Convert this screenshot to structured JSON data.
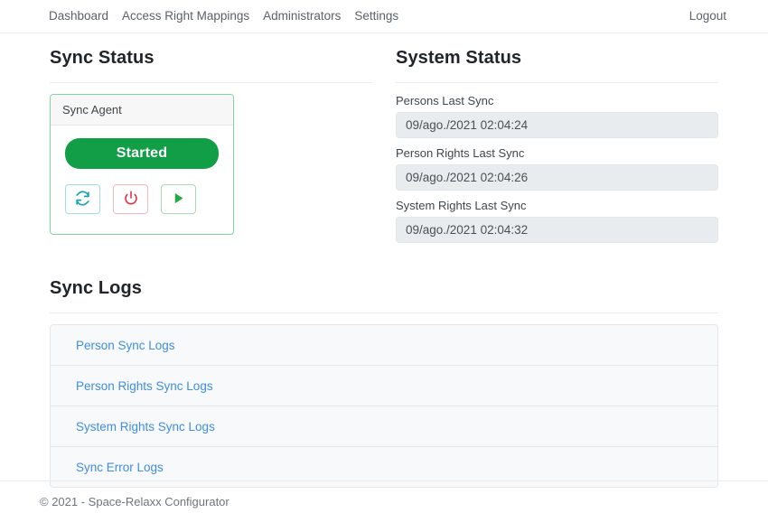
{
  "navbar": {
    "links": [
      {
        "label": "Dashboard"
      },
      {
        "label": "Access Right Mappings"
      },
      {
        "label": "Administrators"
      },
      {
        "label": "Settings"
      }
    ],
    "logout_label": "Logout"
  },
  "sync_status": {
    "title": "Sync Status",
    "card": {
      "header": "Sync Agent",
      "status_label": "Started",
      "status_color": "#119e46",
      "actions": [
        {
          "name": "refresh-icon",
          "color": "#17a2b8",
          "border": "#9fdfe8"
        },
        {
          "name": "power-icon",
          "color": "#dc3545",
          "border": "#f3b7bf"
        },
        {
          "name": "play-icon",
          "color": "#28a745",
          "border": "#a5ddb8"
        }
      ]
    }
  },
  "system_status": {
    "title": "System Status",
    "fields": [
      {
        "label": "Persons Last Sync",
        "value": "09/ago./2021 02:04:24"
      },
      {
        "label": "Person Rights Last Sync",
        "value": "09/ago./2021 02:04:26"
      },
      {
        "label": "System Rights Last Sync",
        "value": "09/ago./2021 02:04:32"
      }
    ]
  },
  "sync_logs": {
    "title": "Sync Logs",
    "items": [
      {
        "label": "Person Sync Logs"
      },
      {
        "label": "Person Rights Sync Logs"
      },
      {
        "label": "System Rights Sync Logs"
      },
      {
        "label": "Sync Error Logs"
      }
    ],
    "link_color": "#3f8de0"
  },
  "footer": {
    "text": "© 2021 - Space-Relaxx Configurator"
  }
}
